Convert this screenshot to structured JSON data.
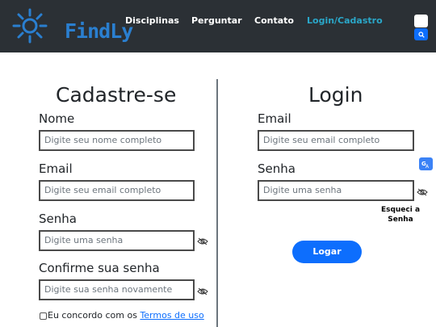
{
  "header": {
    "brand": "FindLy",
    "nav": [
      "Disciplinas",
      "Perguntar",
      "Contato",
      "Login/Cadastro"
    ]
  },
  "signup": {
    "title": "Cadastre-se",
    "name_label": "Nome",
    "name_placeholder": "Digite seu nome completo",
    "email_label": "Email",
    "email_placeholder": "Digite seu email completo",
    "password_label": "Senha",
    "password_placeholder": "Digite uma senha",
    "confirm_label": "Confirme sua senha",
    "confirm_placeholder": "Digite sua senha novamente",
    "agree_text": "Eu concordo com os ",
    "terms_link": "Termos de uso"
  },
  "login": {
    "title": "Login",
    "email_label": "Email",
    "email_placeholder": "Digite seu email completo",
    "password_label": "Senha",
    "password_placeholder": "Digite uma senha",
    "forgot_line1": "Esqueci a",
    "forgot_line2": "Senha",
    "submit_label": "Logar"
  },
  "icons": {
    "logo": "sun-logo-icon",
    "search": "search-icon",
    "eye": "eye-slash-icon",
    "translate": "translate-icon"
  },
  "colors": {
    "navbar": "#2b3035",
    "brand": "#2a7fd0",
    "active_link": "#2aa7c9",
    "primary": "#0d6efd"
  }
}
